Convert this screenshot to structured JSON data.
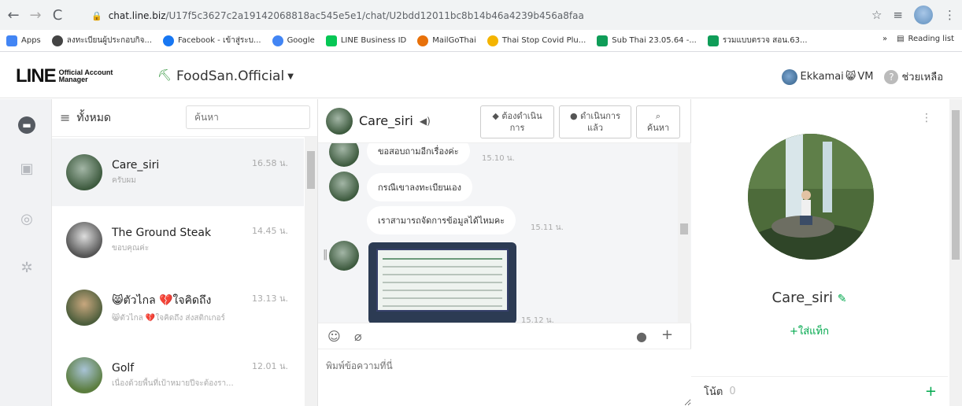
{
  "browser": {
    "url_domain": "chat.line.biz",
    "url_path": "/U17f5c3627c2a19142068818ac545e5e1/chat/U2bdd12011bc8b14b46a4239b456a8faa",
    "icons": [
      "back-icon",
      "forward-icon",
      "reload-icon",
      "lock-icon",
      "star-icon",
      "playlist-icon",
      "kebab-icon"
    ]
  },
  "bookmarks": {
    "items": [
      {
        "label": "Apps",
        "color": "#4285f4"
      },
      {
        "label": "ลงทะเบียนผู้ประกอบกิจ...",
        "color": "#444444"
      },
      {
        "label": "Facebook - เข้าสู่ระบ...",
        "color": "#1877f2"
      },
      {
        "label": "Google",
        "color": "#4285f4"
      },
      {
        "label": "LINE Business ID",
        "color": "#06c755"
      },
      {
        "label": "MailGoThai",
        "color": "#e8710a"
      },
      {
        "label": "Thai Stop Covid Plu...",
        "color": "#f4b400"
      },
      {
        "label": "Sub Thai 23.05.64 -...",
        "color": "#0f9d58"
      },
      {
        "label": "รวมแบบตรวจ สอน.63...",
        "color": "#0f9d58"
      }
    ],
    "more": "»",
    "reading_list": "Reading list"
  },
  "header": {
    "logo_word": "LINE",
    "logo_sub1": "Official Account",
    "logo_sub2": "Manager",
    "account_name": "FoodSan.Official",
    "user_name": "Ekkamai",
    "user_suffix": "VM",
    "help_label": "ช่วยเหลือ"
  },
  "list": {
    "filter_label": "ทั้งหมด",
    "search_placeholder": "ค้นหา",
    "chats": [
      {
        "name": "Care_siri",
        "preview": "ครับผม",
        "time": "16.58 น."
      },
      {
        "name": "The Ground Steak",
        "preview": "ขอบคุณค่ะ",
        "time": "14.45 น."
      },
      {
        "name": "😸ตัวไกล 💔ใจคิดถึง",
        "preview": "😸ตัวไกล 💔ใจคิดถึง ส่งสติกเกอร์",
        "time": "13.13 น."
      },
      {
        "name": "Golf",
        "preview": "เนื่องด้วยพื้นที่เป้าหมายปีจะต้องรา...",
        "time": "12.01 น."
      }
    ]
  },
  "chat": {
    "name": "Care_siri",
    "btn_todo": "ต้องดำเนินการ",
    "btn_todo_l1": "ต้องดำเนิน",
    "btn_todo_l2": "การ",
    "btn_done_l1": "ดำเนินการ",
    "btn_done_l2": "แล้ว",
    "btn_search": "ค้นหา",
    "messages": [
      {
        "text": "ขอสอบถามอีกเรื่องค่ะ",
        "time": "15.10 น."
      },
      {
        "text": "กรณีเขาลงทะเบียนเอง",
        "time": ""
      },
      {
        "text": "เราสามารถจัดการข้อมูลได้ไหมคะ",
        "time": "15.11 น."
      },
      {
        "text": "",
        "time": "15.12 น."
      }
    ],
    "composer_placeholder": "พิมพ์ข้อความที่นี่"
  },
  "profile": {
    "name": "Care_siri",
    "add_tag": "+ใส่แท็ก",
    "notes_label": "โน้ต",
    "notes_count": "0"
  }
}
